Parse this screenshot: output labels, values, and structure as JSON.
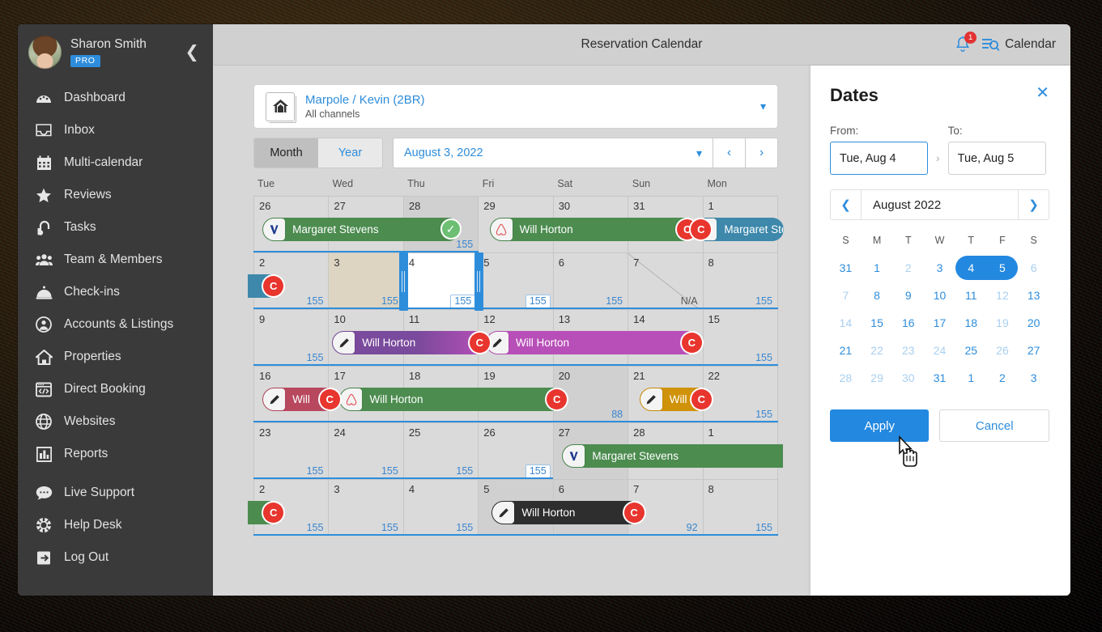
{
  "sidebar": {
    "user": {
      "name": "Sharon Smith",
      "badge": "PRO"
    },
    "collapse_icon": "chevron-left-icon",
    "items": [
      {
        "label": "Dashboard",
        "icon": "dashboard-icon"
      },
      {
        "label": "Inbox",
        "icon": "inbox-icon"
      },
      {
        "label": "Multi-calendar",
        "icon": "calendar-icon"
      },
      {
        "label": "Reviews",
        "icon": "star-icon"
      },
      {
        "label": "Tasks",
        "icon": "vacuum-icon"
      },
      {
        "label": "Team & Members",
        "icon": "people-icon"
      },
      {
        "label": "Check-ins",
        "icon": "bell-desk-icon"
      },
      {
        "label": "Accounts & Listings",
        "icon": "user-circle-icon"
      },
      {
        "label": "Properties",
        "icon": "home-icon"
      },
      {
        "label": "Direct Booking",
        "icon": "code-window-icon"
      },
      {
        "label": "Websites",
        "icon": "globe-icon"
      },
      {
        "label": "Reports",
        "icon": "bar-chart-icon"
      },
      {
        "label": "Live Support",
        "icon": "chat-icon"
      },
      {
        "label": "Help Desk",
        "icon": "lifebuoy-icon"
      },
      {
        "label": "Log Out",
        "icon": "logout-icon"
      }
    ]
  },
  "topbar": {
    "title": "Reservation Calendar",
    "notifications": {
      "icon": "bell-icon",
      "count": "1"
    },
    "calendar_button": {
      "label": "Calendar",
      "icon": "list-search-icon"
    }
  },
  "property": {
    "icon": "home-stack-icon",
    "name": "Marpole / Kevin (2BR)",
    "channels": "All channels",
    "caret_icon": "chevron-down-icon"
  },
  "toolbar": {
    "view_month": "Month",
    "view_year": "Year",
    "active_view": "Month",
    "date_value": "August 3, 2022",
    "date_caret_icon": "chevron-down-icon",
    "prev_icon": "chevron-left-icon",
    "next_icon": "chevron-right-icon"
  },
  "calendar": {
    "day_headers": [
      "Tue",
      "Wed",
      "Thu",
      "Fri",
      "Sat",
      "Sun",
      "Mon"
    ],
    "weeks": [
      {
        "days": [
          {
            "num": "26",
            "price": ""
          },
          {
            "num": "27",
            "price": ""
          },
          {
            "num": "28",
            "price": "155",
            "shade": "dim"
          },
          {
            "num": "29",
            "price": ""
          },
          {
            "num": "30",
            "price": ""
          },
          {
            "num": "31",
            "price": ""
          },
          {
            "num": "1",
            "price": ""
          }
        ]
      },
      {
        "days": [
          {
            "num": "2",
            "price": "155"
          },
          {
            "num": "3",
            "price": "155",
            "shade": "beige"
          },
          {
            "num": "4",
            "price": "155",
            "shade": "white",
            "price_boxed": true
          },
          {
            "num": "5",
            "price": "155",
            "price_boxed": true
          },
          {
            "num": "6",
            "price": "155"
          },
          {
            "num": "7",
            "price": "N/A",
            "na": true,
            "diagonal": true
          },
          {
            "num": "8",
            "price": "155"
          }
        ]
      },
      {
        "days": [
          {
            "num": "9",
            "price": "155"
          },
          {
            "num": "10",
            "price": ""
          },
          {
            "num": "11",
            "price": ""
          },
          {
            "num": "12",
            "price": ""
          },
          {
            "num": "13",
            "price": ""
          },
          {
            "num": "14",
            "price": ""
          },
          {
            "num": "15",
            "price": "155"
          }
        ]
      },
      {
        "days": [
          {
            "num": "16",
            "price": ""
          },
          {
            "num": "17",
            "price": ""
          },
          {
            "num": "18",
            "price": ""
          },
          {
            "num": "19",
            "price": ""
          },
          {
            "num": "20",
            "price": "88",
            "shade": "dim"
          },
          {
            "num": "21",
            "price": ""
          },
          {
            "num": "22",
            "price": "155"
          }
        ]
      },
      {
        "days": [
          {
            "num": "23",
            "price": "155"
          },
          {
            "num": "24",
            "price": "155"
          },
          {
            "num": "25",
            "price": "155"
          },
          {
            "num": "26",
            "price": "155",
            "price_boxed": true
          },
          {
            "num": "27",
            "price": "",
            "shade": "dim"
          },
          {
            "num": "28",
            "price": ""
          },
          {
            "num": "1",
            "price": ""
          }
        ]
      },
      {
        "days": [
          {
            "num": "2",
            "price": "155"
          },
          {
            "num": "3",
            "price": "155"
          },
          {
            "num": "4",
            "price": "155"
          },
          {
            "num": "5",
            "price": "",
            "shade": "dim"
          },
          {
            "num": "6",
            "price": "",
            "shade": "dim"
          },
          {
            "num": "7",
            "price": "92"
          },
          {
            "num": "8",
            "price": "155"
          }
        ]
      }
    ],
    "bookings": [
      {
        "guest": "Margaret Stevens",
        "color": "#4c8c4f",
        "icon": "vrbo-icon",
        "week": 0,
        "start": 0.12,
        "span": 2.63,
        "end_marker": "check",
        "label": "Margaret Stevens"
      },
      {
        "guest": "Will Horton",
        "color": "#4c8c4f",
        "icon": "airbnb-icon",
        "week": 0,
        "start": 3.15,
        "span": 2.74,
        "end_marker": "c",
        "label": "Will Horton"
      },
      {
        "guest": "Margaret Stevens",
        "color": "#3d88ab",
        "icon": "c-marker",
        "week": 0,
        "start": 5.88,
        "span": 1.2,
        "end_marker": "",
        "label": "Margaret Stevens"
      },
      {
        "guest": "Margaret Stevens",
        "color": "#3d88ab",
        "icon": "",
        "week": 1,
        "start": -0.08,
        "span": 0.45,
        "end_marker": "c",
        "label": ""
      },
      {
        "guest": "Will Horton",
        "color": "#7a4a9c",
        "color2": "#b84fb8",
        "icon": "pencil-icon",
        "week": 2,
        "start": 1.05,
        "span": 2.07,
        "end_marker": "c",
        "label": "Will Horton"
      },
      {
        "guest": "Will Horton",
        "color": "#b84fb8",
        "icon": "pencil-icon",
        "week": 2,
        "start": 3.1,
        "span": 2.85,
        "end_marker": "c",
        "label": "Will Horton"
      },
      {
        "guest": "Will",
        "color": "#b8485e",
        "icon": "pencil-icon",
        "week": 3,
        "start": 0.12,
        "span": 1.0,
        "end_marker": "c",
        "label": "Will"
      },
      {
        "guest": "Will Horton",
        "color": "#4c8c4f",
        "icon": "airbnb-icon",
        "week": 3,
        "start": 1.15,
        "span": 3.0,
        "end_marker": "c",
        "label": "Will Horton"
      },
      {
        "guest": "Will",
        "color": "#d09208",
        "icon": "pencil-icon",
        "week": 3,
        "start": 5.15,
        "span": 0.93,
        "end_marker": "c",
        "label": "Will"
      },
      {
        "guest": "Margaret Stevens",
        "color": "#4c8c4f",
        "icon": "vrbo-icon",
        "week": 4,
        "start": 4.12,
        "span": 2.95,
        "end_marker": "",
        "label": "Margaret Stevens",
        "square_end": true
      },
      {
        "guest": "Margaret Stevens",
        "color": "#4c8c4f",
        "icon": "",
        "week": 5,
        "start": -0.08,
        "span": 0.45,
        "end_marker": "c",
        "label": ""
      },
      {
        "guest": "Will Horton",
        "color": "#2e2e2e",
        "icon": "pencil-icon",
        "week": 5,
        "start": 3.18,
        "span": 2.0,
        "end_marker": "c",
        "label": "Will Horton"
      }
    ],
    "selection": {
      "from_col": 2,
      "to_col": 3,
      "week": 1
    }
  },
  "dates_panel": {
    "title": "Dates",
    "close_icon": "close-icon",
    "from_label": "From:",
    "to_label": "To:",
    "from_value": "Tue, Aug 4",
    "to_value": "Tue, Aug 5",
    "arrow_icon": "chevron-right-icon",
    "mini": {
      "prev_icon": "chevron-left-icon",
      "next_icon": "chevron-right-icon",
      "month": "August 2022",
      "dow": [
        "S",
        "M",
        "T",
        "W",
        "T",
        "F",
        "S"
      ],
      "rows": [
        [
          {
            "d": "31"
          },
          {
            "d": "1"
          },
          {
            "d": "2",
            "mute": true
          },
          {
            "d": "3"
          },
          {
            "d": "4",
            "sel": true
          },
          {
            "d": "5",
            "sel": true
          },
          {
            "d": "6",
            "mute": true
          }
        ],
        [
          {
            "d": "7",
            "mute": true
          },
          {
            "d": "8"
          },
          {
            "d": "9"
          },
          {
            "d": "10"
          },
          {
            "d": "11"
          },
          {
            "d": "12",
            "mute": true
          },
          {
            "d": "13"
          }
        ],
        [
          {
            "d": "14",
            "mute": true
          },
          {
            "d": "15"
          },
          {
            "d": "16"
          },
          {
            "d": "17"
          },
          {
            "d": "18"
          },
          {
            "d": "19",
            "mute": true
          },
          {
            "d": "20"
          }
        ],
        [
          {
            "d": "21"
          },
          {
            "d": "22",
            "mute": true
          },
          {
            "d": "23",
            "mute": true
          },
          {
            "d": "24",
            "mute": true
          },
          {
            "d": "25"
          },
          {
            "d": "26",
            "mute": true
          },
          {
            "d": "27"
          }
        ],
        [
          {
            "d": "28",
            "mute": true
          },
          {
            "d": "29",
            "mute": true
          },
          {
            "d": "30",
            "mute": true
          },
          {
            "d": "31"
          },
          {
            "d": "1"
          },
          {
            "d": "2"
          },
          {
            "d": "3"
          }
        ]
      ]
    },
    "apply_label": "Apply",
    "cancel_label": "Cancel"
  },
  "colors": {
    "accent": "#2388e0",
    "sidebar_bg": "#3a3a3a",
    "marker_red": "#e8352e",
    "green": "#4c8c4f"
  }
}
